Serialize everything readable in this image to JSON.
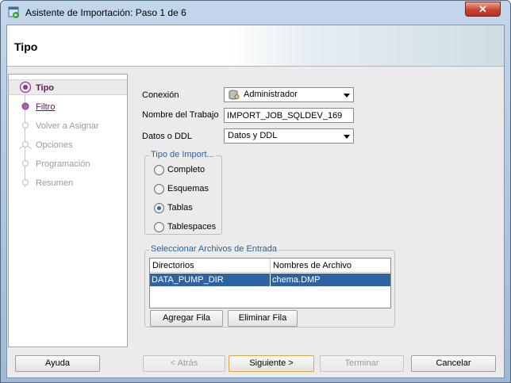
{
  "window": {
    "title": "Asistente de Importación: Paso 1 de 6",
    "close_label": "✕"
  },
  "header": {
    "title": "Tipo"
  },
  "steps": [
    {
      "label": "Tipo",
      "state": "active"
    },
    {
      "label": "Filtro",
      "state": "link"
    },
    {
      "label": "Volver a Asignar",
      "state": "disabled"
    },
    {
      "label": "Opciones",
      "state": "disabled"
    },
    {
      "label": "Programación",
      "state": "disabled"
    },
    {
      "label": "Resumen",
      "state": "disabled"
    }
  ],
  "form": {
    "connection_label": "Conexión",
    "connection_value": "Administrador",
    "job_name_label": "Nombre del Trabajo",
    "job_name_value": "IMPORT_JOB_SQLDEV_169",
    "data_ddl_label": "Datos o DDL",
    "data_ddl_value": "Datos y DDL"
  },
  "import_type": {
    "title": "Tipo de Import...",
    "options": [
      "Completo",
      "Esquemas",
      "Tablas",
      "Tablespaces"
    ],
    "selected": "Tablas"
  },
  "input_files": {
    "title": "Seleccionar Archivos de Entrada",
    "columns": [
      "Directorios",
      "Nombres de Archivo"
    ],
    "rows": [
      [
        "DATA_PUMP_DIR",
        "chema.DMP"
      ]
    ],
    "add_row": "Agregar Fila",
    "delete_row": "Eliminar Fila"
  },
  "footer": {
    "help": "Ayuda",
    "back": "< Atrás",
    "next": "Siguiente >",
    "finish": "Terminar",
    "cancel": "Cancelar"
  },
  "colors": {
    "accent": "#2f62a0",
    "step_active": "#5a1d5a",
    "group_title": "#2d5f9b"
  }
}
